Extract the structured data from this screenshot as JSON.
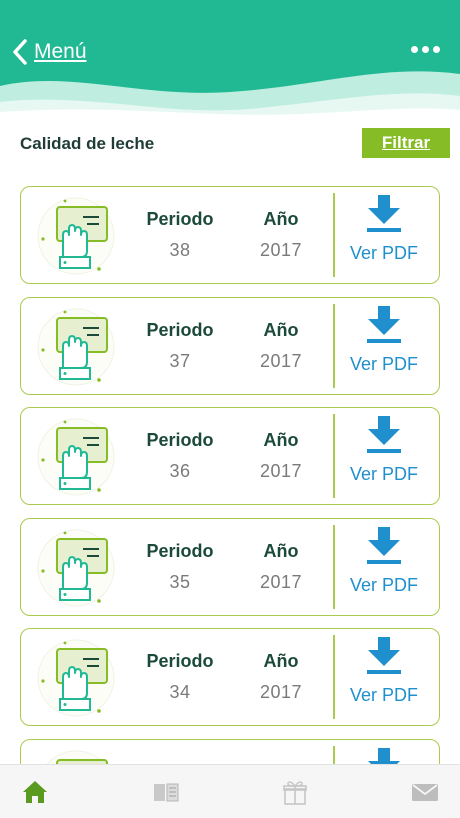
{
  "header": {
    "back_label": "Menú",
    "colors": {
      "primary": "#21b994",
      "wave_light": "#bfeee0"
    }
  },
  "section": {
    "title": "Calidad de leche",
    "filter_label": "Filtrar"
  },
  "cards": [
    {
      "period_label": "Periodo",
      "period": "38",
      "year_label": "Año",
      "year": "2017",
      "pdf_label": "Ver PDF"
    },
    {
      "period_label": "Periodo",
      "period": "37",
      "year_label": "Año",
      "year": "2017",
      "pdf_label": "Ver PDF"
    },
    {
      "period_label": "Periodo",
      "period": "36",
      "year_label": "Año",
      "year": "2017",
      "pdf_label": "Ver PDF"
    },
    {
      "period_label": "Periodo",
      "period": "35",
      "year_label": "Año",
      "year": "2017",
      "pdf_label": "Ver PDF"
    },
    {
      "period_label": "Periodo",
      "period": "34",
      "year_label": "Año",
      "year": "2017",
      "pdf_label": "Ver PDF"
    },
    {
      "period_label": "",
      "period": "",
      "year_label": "",
      "year": "",
      "pdf_label": ""
    }
  ],
  "tabbar": {
    "items": [
      "home-icon",
      "book-icon",
      "gift-icon",
      "mail-icon"
    ],
    "active": "home-icon",
    "active_color": "#5a9a1f"
  }
}
